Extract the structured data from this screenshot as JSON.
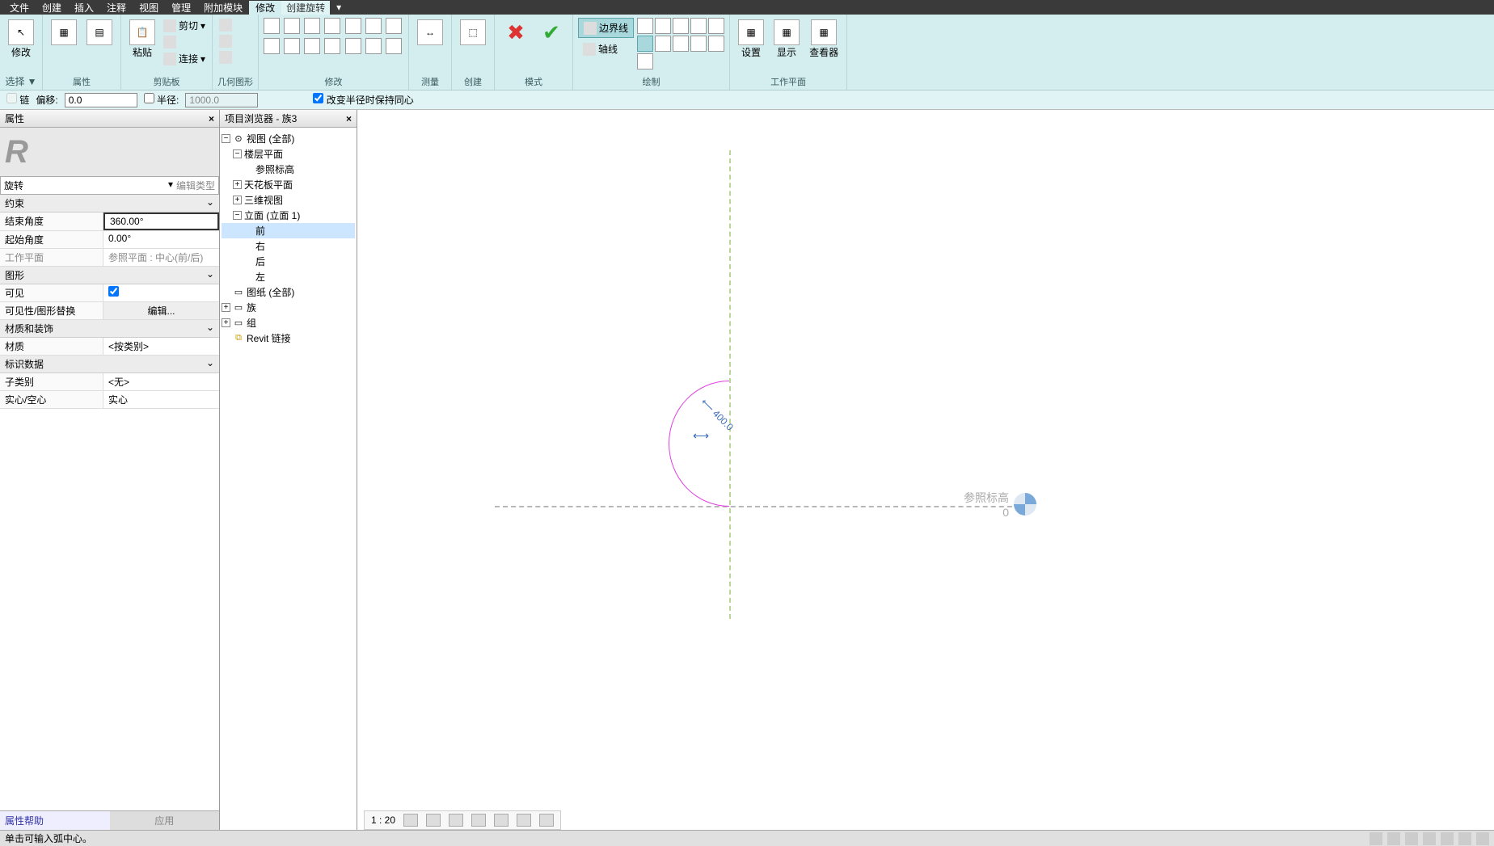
{
  "menu": {
    "items": [
      "文件",
      "创建",
      "插入",
      "注释",
      "视图",
      "管理",
      "附加模块"
    ],
    "active": "修改",
    "context": "创建旋转"
  },
  "ribbon": {
    "groups": {
      "select": {
        "label": "选择",
        "arrow": "▼",
        "btn": "修改"
      },
      "properties": {
        "label": "属性"
      },
      "clipboard": {
        "label": "剪贴板",
        "paste": "粘贴",
        "cut": "剪切",
        "connect": "连接"
      },
      "geometry": {
        "label": "几何图形"
      },
      "modify": {
        "label": "修改"
      },
      "measure": {
        "label": "测量"
      },
      "create": {
        "label": "创建"
      },
      "mode": {
        "label": "模式"
      },
      "draw": {
        "label": "绘制",
        "boundary": "边界线",
        "axis": "轴线"
      },
      "workplane": {
        "label": "工作平面",
        "set": "设置",
        "show": "显示",
        "viewer": "查看器"
      }
    }
  },
  "options": {
    "chain": "链",
    "offset_label": "偏移:",
    "offset_value": "0.0",
    "radius_label": "半径:",
    "radius_value": "1000.0",
    "concentric": "改变半径时保持同心"
  },
  "properties": {
    "title": "属性",
    "type": "旋转",
    "edit_type": "编辑类型",
    "cats": {
      "constraints": "约束",
      "graphics": "图形",
      "materials": "材质和装饰",
      "identity": "标识数据"
    },
    "rows": {
      "end_angle": {
        "k": "结束角度",
        "v": "360.00°"
      },
      "start_angle": {
        "k": "起始角度",
        "v": "0.00°"
      },
      "workplane": {
        "k": "工作平面",
        "v": "参照平面 : 中心(前/后)"
      },
      "visible": {
        "k": "可见",
        "v": "☑"
      },
      "vis_override": {
        "k": "可见性/图形替换",
        "v": "编辑..."
      },
      "material": {
        "k": "材质",
        "v": "<按类别>"
      },
      "subcat": {
        "k": "子类别",
        "v": "<无>"
      },
      "solid": {
        "k": "实心/空心",
        "v": "实心"
      }
    },
    "help": "属性帮助",
    "apply": "应用"
  },
  "browser": {
    "title": "项目浏览器 - 族3",
    "nodes": {
      "views": "视图 (全部)",
      "floorplans": "楼层平面",
      "ref_level": "参照标高",
      "ceiling": "天花板平面",
      "threed": "三维视图",
      "elev": "立面 (立面 1)",
      "front": "前",
      "right": "右",
      "back": "后",
      "left": "左",
      "sheets": "图纸 (全部)",
      "families": "族",
      "groups": "组",
      "links": "Revit 链接"
    }
  },
  "canvas": {
    "dim_value": "400.0",
    "level_name": "参照标高",
    "level_val": "0"
  },
  "viewctrl": {
    "scale": "1 : 20"
  },
  "status": {
    "hint": "单击可输入弧中心。"
  }
}
